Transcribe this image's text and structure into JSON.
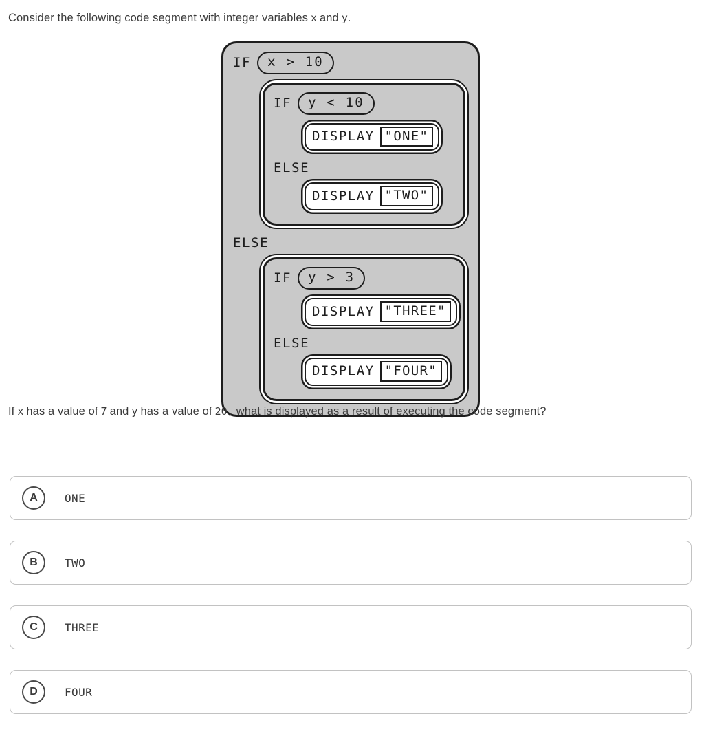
{
  "intro": {
    "before_x": "Consider the following code segment with integer variables",
    "var_x": "x",
    "and": "and",
    "var_y": "y",
    "period": "."
  },
  "question": {
    "if_word": "If",
    "var_x": "x",
    "mid1": "has a value of",
    "x_value": "7",
    "and": "and",
    "var_y": "y",
    "mid2": "has a value of",
    "y_value": "20,",
    "tail": "what is displayed as a result of executing the code segment?"
  },
  "code": {
    "outer_if_keyword": "IF",
    "outer_if_condition": "x > 10",
    "outer_else_keyword": "ELSE",
    "then_branch": {
      "if_keyword": "IF",
      "if_condition": "y < 10",
      "then_display_keyword": "DISPLAY",
      "then_display_value": "\"ONE\"",
      "else_keyword": "ELSE",
      "else_display_keyword": "DISPLAY",
      "else_display_value": "\"TWO\""
    },
    "else_branch": {
      "if_keyword": "IF",
      "if_condition": "y > 3",
      "then_display_keyword": "DISPLAY",
      "then_display_value": "\"THREE\"",
      "else_keyword": "ELSE",
      "else_display_keyword": "DISPLAY",
      "else_display_value": "\"FOUR\""
    }
  },
  "choices": [
    {
      "badge": "A",
      "label": "ONE"
    },
    {
      "badge": "B",
      "label": "TWO"
    },
    {
      "badge": "C",
      "label": "THREE"
    },
    {
      "badge": "D",
      "label": "FOUR"
    }
  ],
  "colors": {
    "code_background": "#c9c9c9",
    "code_stroke": "#1d1d1d",
    "text": "#3a3a3a",
    "card_border": "#c2c2c2",
    "badge_border": "#4a4a4a"
  }
}
